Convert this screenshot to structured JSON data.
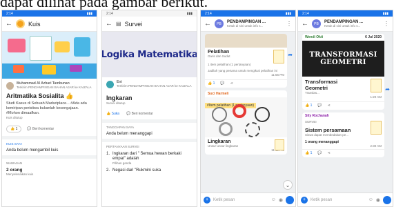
{
  "caption": "dapat dilihat pada gambar berikut.",
  "status_time": "2:14",
  "phone1": {
    "title": "Kuis",
    "author": "Muhammad Al Azhari Tambunan",
    "posted_in_prefix": "Terkirim",
    "posted_in": "PENDAMPINGAN BAHAN AJAR ke KAIZALA",
    "quiz_title": "Aritmatika Sosialita 👍",
    "desc": "Studi Kasus di Sebuah Marketplace... #Ada ada kemiripan peristiwa bukanlah kesengajaan. #Mohon dimaafkan.",
    "status": "Kuis ditutup",
    "like_count": "1",
    "comment_label": "Beri komentar",
    "section_label": "KUIS SAYA",
    "section_text": "Anda belum mengambil kuis",
    "wawasan_label": "WAWASAN",
    "wawasan_count": "2 orang",
    "wawasan_sub": "Menyelesaikan kuis"
  },
  "phone2": {
    "title": "Survei",
    "banner_text": "Logika Matematika",
    "author": "Eni",
    "posted_in_prefix": "Terkirim",
    "posted_in": "PENDAMPINGAN BAHAN AJAR ke KAIZALA",
    "survey_title": "Ingkaran",
    "survey_status": "Survei ditutup",
    "like_label": "Suka",
    "comment_label": "Beri komentar",
    "response_label": "TANGGAPAN SAYA",
    "response_text": "Anda belum menanggapi",
    "questions_label": "PERTANYAAN SURVEI",
    "q1": "Ingkaran dari \" Semua hewan berkaki empat\" adalah",
    "q1_sub": "Pilihan ganda",
    "q2": "Negasi dari \"Rukmini suka"
  },
  "phone3": {
    "group_initials": "PB",
    "group_name": "PENDAMPINGAN ...",
    "group_sub": "Ketuk di sini untuk info s...",
    "card1_title": "Pelatihan",
    "card1_sub": "Garis dan Sudut",
    "card1_meta": "1 item pelatihan (1 pertanyaan)",
    "card1_desc": "Jadilah yang pertama untuk mengikuti pelatihan ini",
    "card1_time": "11:56 PM",
    "card1_likes": "1",
    "sender2": "Suci Harmeli",
    "card2_banner": "#Item pelatihan (1 pertanyaan)",
    "card2_title": "Lingkaran",
    "card2_sub": "Unsur-unsur lingkaran",
    "card2_time": "11:12 PM",
    "input_placeholder": "Ketik pesan"
  },
  "phone4": {
    "group_initials": "PB",
    "group_name": "PENDAMPINGAN ...",
    "group_sub": "Ketuk di sini untuk info s...",
    "sender1": "Wendi Okti",
    "date": "6 Jul 2020",
    "banner_line1": "TRANSFORMASI",
    "banner_line2": "GEOMETRI",
    "card1_title": "Transformasi Geometri",
    "card1_sub": "Translas...",
    "card1_time": "1:20 AM",
    "card1_likes": "1",
    "sender2": "Sity Rochanah",
    "card2_label": "SURVEI",
    "card2_title": "Sistem persamaan",
    "card2_sub": "Siswa dapat membedakan pe...",
    "card2_meta": "1 orang menanggapi",
    "card2_time": "2:30 AM",
    "card2_likes": "1",
    "input_placeholder": "Ketik pesan"
  }
}
